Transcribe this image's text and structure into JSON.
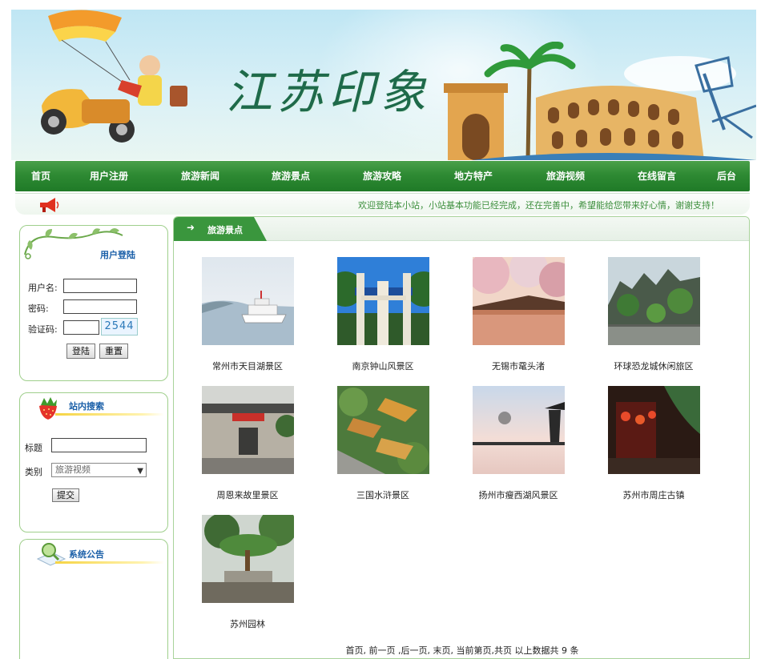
{
  "banner": {
    "title": "江苏印象"
  },
  "nav": {
    "items": [
      "首页",
      "用户注册",
      "旅游新闻",
      "旅游景点",
      "旅游攻略",
      "地方特产",
      "旅游视频",
      "在线留言",
      "后台"
    ]
  },
  "notice": {
    "text": "欢迎登陆本小站，小站基本功能已经完成，还在完善中，希望能给您带来好心情，谢谢支持！"
  },
  "login": {
    "title": "用户登陆",
    "username_label": "用户名:",
    "password_label": "密码:",
    "captcha_label": "验证码:",
    "captcha_code": "2544",
    "login_button": "登陆",
    "reset_button": "重置"
  },
  "search": {
    "title": "站内搜索",
    "title_label": "标题",
    "category_label": "类别",
    "category_selected": "旅游视频",
    "submit_button": "提交"
  },
  "announce": {
    "title": "系统公告"
  },
  "main": {
    "tab_label": "旅游景点",
    "spots": [
      {
        "name": "常州市天目湖景区"
      },
      {
        "name": "南京钟山风景区"
      },
      {
        "name": "无锡市鼋头渚"
      },
      {
        "name": "环球恐龙城休闲旅区"
      },
      {
        "name": "周恩来故里景区"
      },
      {
        "name": "三国水浒景区"
      },
      {
        "name": "扬州市瘦西湖风景区"
      },
      {
        "name": "苏州市周庄古镇"
      },
      {
        "name": "苏州园林"
      }
    ],
    "pager": "首页, 前一页 ,后一页, 末页, 当前第页,共页 以上数据共 9 条"
  },
  "colors": {
    "nav_green": "#2e8a33",
    "link_blue": "#1a5fa8",
    "border_green": "#a9d39b"
  }
}
